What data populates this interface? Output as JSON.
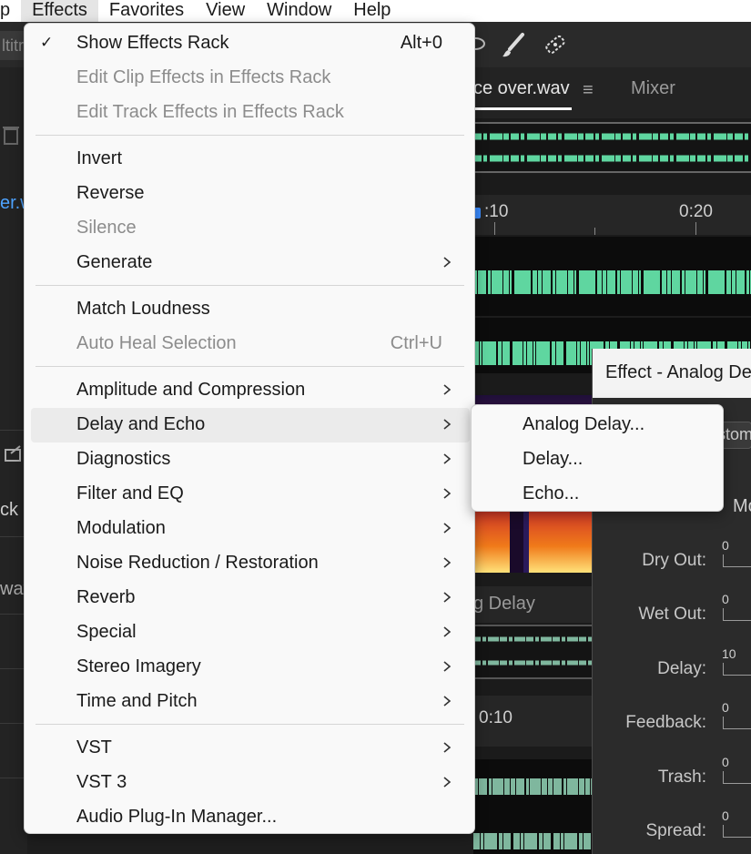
{
  "menubar": {
    "items": [
      {
        "label": "p"
      },
      {
        "label": "Effects"
      },
      {
        "label": "Favorites"
      },
      {
        "label": "View"
      },
      {
        "label": "Window"
      },
      {
        "label": "Help"
      }
    ]
  },
  "background": {
    "toolbar_left_text": "ltitr",
    "left_panel": {
      "file_fragment": "er.w",
      "track_fragment": "ck",
      "wav_fragment": "wav"
    },
    "editor": {
      "tab_name": "ce over.wav",
      "tab_menu": "≡",
      "mixer_tab": "Mixer",
      "ruler_labels": [
        ":10",
        "0:20"
      ],
      "sub_header": "g Delay",
      "ruler2_label": "0:10"
    },
    "effect_dialog": {
      "title": "Effect - Analog De",
      "preset_fragment": "stom",
      "mode_fragment": "Mo",
      "params": [
        {
          "label": "Dry Out:",
          "value": "0"
        },
        {
          "label": "Wet Out:",
          "value": "0"
        },
        {
          "label": "Delay:",
          "value": "10"
        },
        {
          "label": "Feedback:",
          "value": "0"
        },
        {
          "label": "Trash:",
          "value": "0"
        },
        {
          "label": "Spread:",
          "value": "0"
        }
      ]
    },
    "colors": {
      "waveform": "#5fd6a0",
      "waveform_dim": "#7fb79e"
    }
  },
  "effects_menu": {
    "items": [
      {
        "label": "Show Effects Rack",
        "shortcut": "Alt+0",
        "checked": "✓"
      },
      {
        "label": "Edit Clip Effects in Effects Rack",
        "disabled": true
      },
      {
        "label": "Edit Track Effects in Effects Rack",
        "disabled": true
      },
      {
        "label": "Invert"
      },
      {
        "label": "Reverse"
      },
      {
        "label": "Silence",
        "disabled": true
      },
      {
        "label": "Generate",
        "submenu": true
      },
      {
        "label": "Match Loudness"
      },
      {
        "label": "Auto Heal Selection",
        "shortcut": "Ctrl+U",
        "disabled": true
      },
      {
        "label": "Amplitude and Compression",
        "submenu": true
      },
      {
        "label": "Delay and Echo",
        "submenu": true,
        "highlighted": true
      },
      {
        "label": "Diagnostics",
        "submenu": true
      },
      {
        "label": "Filter and EQ",
        "submenu": true
      },
      {
        "label": "Modulation",
        "submenu": true
      },
      {
        "label": "Noise Reduction / Restoration",
        "submenu": true
      },
      {
        "label": "Reverb",
        "submenu": true
      },
      {
        "label": "Special",
        "submenu": true
      },
      {
        "label": "Stereo Imagery",
        "submenu": true
      },
      {
        "label": "Time and Pitch",
        "submenu": true
      },
      {
        "label": "VST",
        "submenu": true
      },
      {
        "label": "VST 3",
        "submenu": true
      },
      {
        "label": "Audio Plug-In Manager..."
      }
    ]
  },
  "delay_echo_submenu": {
    "items": [
      {
        "label": "Analog Delay..."
      },
      {
        "label": "Delay..."
      },
      {
        "label": "Echo..."
      }
    ]
  }
}
